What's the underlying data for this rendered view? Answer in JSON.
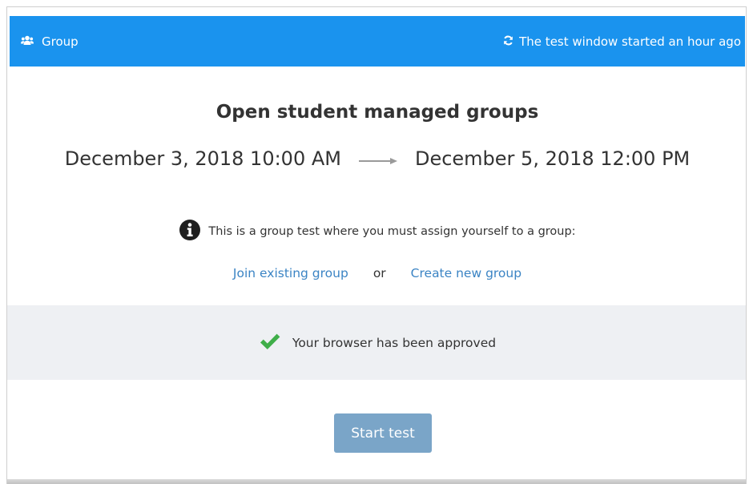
{
  "header": {
    "title": "Group",
    "status": "The test window started an hour ago",
    "left_icon": "users-icon",
    "right_icon": "refresh-icon",
    "background_color": "#1a93ee"
  },
  "main": {
    "title": "Open student managed groups",
    "start_date": "December 3, 2018 10:00 AM",
    "end_date": "December 5, 2018 12:00 PM",
    "info_text": "This is a group test where you must assign yourself to a group:",
    "join_link": "Join existing group",
    "or_text": "or",
    "create_link": "Create new group"
  },
  "browser_check": {
    "text": "Your browser has been approved",
    "icon": "checkmark-icon",
    "icon_color": "#3fae49"
  },
  "actions": {
    "start_label": "Start test",
    "button_color": "#7aa5c8"
  }
}
